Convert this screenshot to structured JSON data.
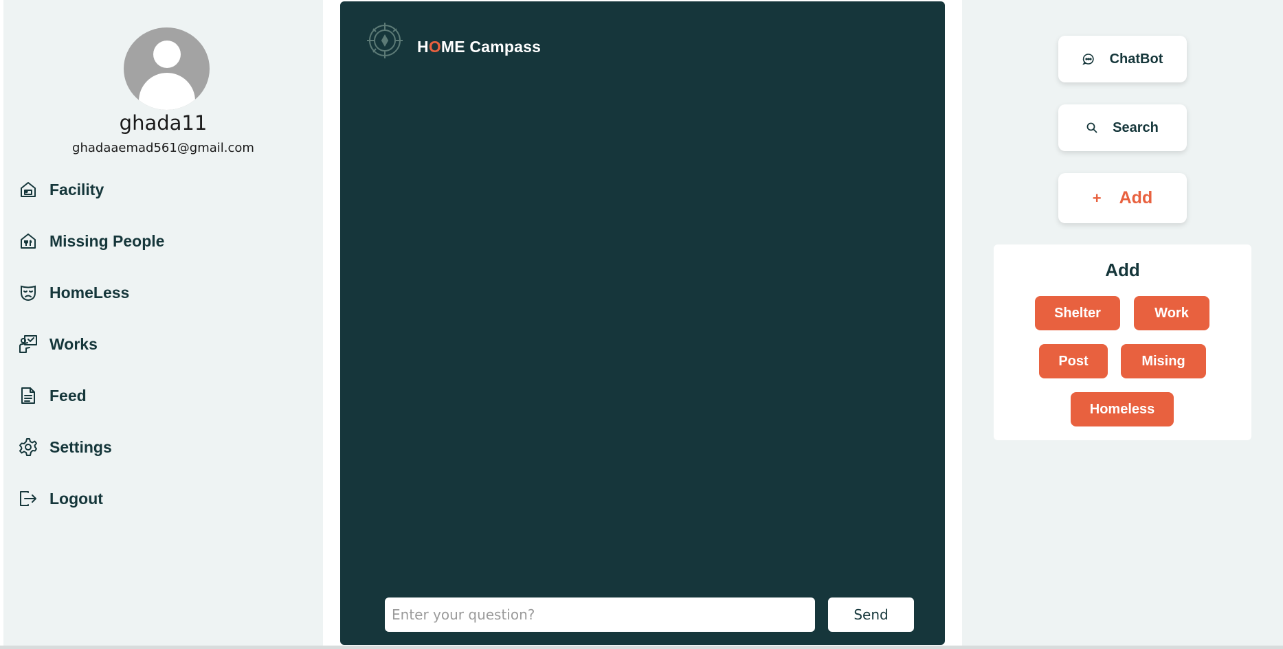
{
  "user": {
    "username": "ghada11",
    "email": "ghadaaemad561@gmail.com"
  },
  "sidebar": {
    "items": [
      {
        "label": "Facility",
        "icon": "facility-icon"
      },
      {
        "label": "Missing People",
        "icon": "missing-people-icon"
      },
      {
        "label": "HomeLess",
        "icon": "mask-icon"
      },
      {
        "label": "Works",
        "icon": "works-icon"
      },
      {
        "label": "Feed",
        "icon": "document-icon"
      },
      {
        "label": "Settings",
        "icon": "gear-icon"
      },
      {
        "label": "Logout",
        "icon": "logout-icon"
      }
    ]
  },
  "chat": {
    "brand_h": "H",
    "brand_o": "O",
    "brand_rest": "ME Campass",
    "input_placeholder": "Enter your question?",
    "send_label": "Send"
  },
  "actions": {
    "chatbot_label": "ChatBot",
    "search_label": "Search",
    "add_label": "Add",
    "add_symbol": "+"
  },
  "add_panel": {
    "title": "Add",
    "options": [
      "Shelter",
      "Work",
      "Post",
      "Mising",
      "Homeless"
    ]
  },
  "colors": {
    "accent": "#e8613f",
    "dark": "#16363b",
    "panel": "#eef3f3"
  }
}
